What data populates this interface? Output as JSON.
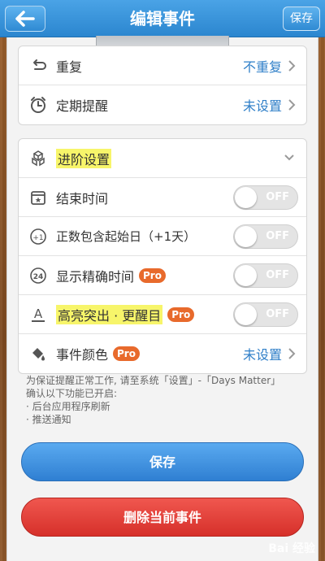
{
  "nav": {
    "title": "编辑事件",
    "save_label": "保存"
  },
  "section1": {
    "repeat": {
      "label": "重复",
      "value": "不重复"
    },
    "reminder": {
      "label": "定期提醒",
      "value": "未设置"
    }
  },
  "advanced": {
    "header": "进阶设置",
    "end_time": {
      "label": "结束时间",
      "state": "OFF"
    },
    "include_start": {
      "label": "正数包含起始日（+1天）",
      "state": "OFF",
      "icon_text": "+1"
    },
    "precise_time": {
      "label": "显示精确时间",
      "badge": "Pro",
      "state": "OFF",
      "icon_text": "24"
    },
    "highlight": {
      "label": "高亮突出 · 更醒目",
      "badge": "Pro",
      "state": "OFF",
      "icon_text": "A"
    },
    "color": {
      "label": "事件颜色",
      "badge": "Pro",
      "value": "未设置"
    }
  },
  "note": {
    "line1": "为保证提醒正常工作, 请至系统「设置」-「Days Matter」 确认以下功能已开启:",
    "item1": "· 后台应用程序刷新",
    "item2": "· 推送通知"
  },
  "buttons": {
    "save": "保存",
    "delete": "删除当前事件"
  },
  "watermark": "Bai  经验",
  "colors": {
    "nav": "#2b86cf",
    "save_button": "#3b8fdc",
    "delete_button": "#e0403a",
    "pro_badge": "#e86a2c",
    "link": "#2f7fc8"
  }
}
